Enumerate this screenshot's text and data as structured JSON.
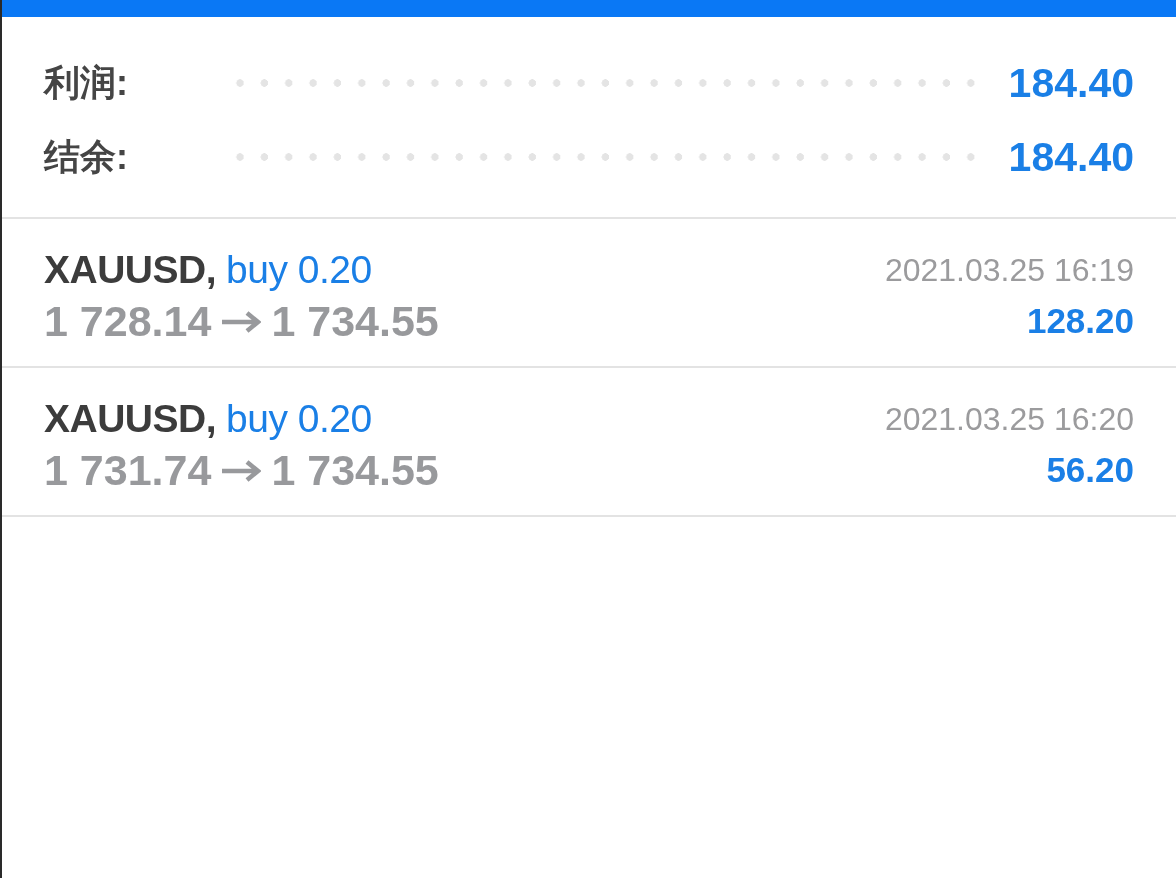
{
  "summary": [
    {
      "label": "利润:",
      "value": "184.40"
    },
    {
      "label": "结余:",
      "value": "184.40"
    }
  ],
  "deals": [
    {
      "symbol": "XAUUSD,",
      "order": "buy 0.20",
      "time": "2021.03.25 16:19",
      "open_price": "1 728.14",
      "close_price": "1 734.55",
      "profit": "128.20"
    },
    {
      "symbol": "XAUUSD,",
      "order": "buy 0.20",
      "time": "2021.03.25 16:20",
      "open_price": "1 731.74",
      "close_price": "1 734.55",
      "profit": "56.20"
    }
  ]
}
